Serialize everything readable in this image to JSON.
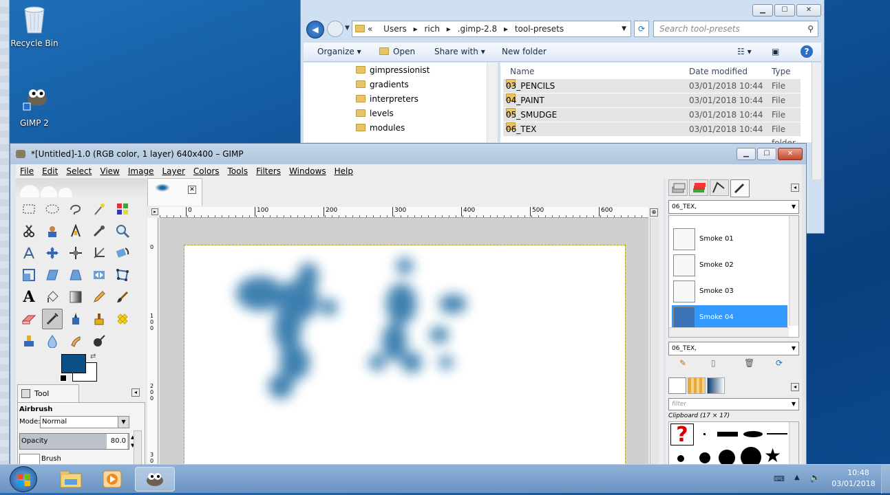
{
  "desktop": {
    "icons": [
      {
        "label": "Recycle Bin"
      },
      {
        "label": "GIMP 2"
      }
    ]
  },
  "explorer": {
    "window_controls": {
      "minimize": "▁",
      "maximize": "☐",
      "close": "✕"
    },
    "breadcrumb": [
      "«",
      "Users",
      "rich",
      ".gimp-2.8",
      "tool-presets"
    ],
    "search_placeholder": "Search tool-presets",
    "toolbar": {
      "organize": "Organize",
      "open": "Open",
      "share_with": "Share with",
      "new_folder": "New folder"
    },
    "nav_items": [
      "gimpressionist",
      "gradients",
      "interpreters",
      "levels",
      "modules"
    ],
    "columns": {
      "name": "Name",
      "date": "Date modified",
      "type": "Type"
    },
    "files": [
      {
        "name": "03_PENCILS",
        "date": "03/01/2018 10:44",
        "type": "File folder"
      },
      {
        "name": "04_PAINT",
        "date": "03/01/2018 10:44",
        "type": "File folder"
      },
      {
        "name": "05_SMUDGE",
        "date": "03/01/2018 10:44",
        "type": "File folder"
      },
      {
        "name": "06_TEX",
        "date": "03/01/2018 10:44",
        "type": "File folder"
      }
    ]
  },
  "gimp": {
    "title": "*[Untitled]-1.0 (RGB color, 1 layer) 640x400 – GIMP",
    "menu": [
      "File",
      "Edit",
      "Select",
      "View",
      "Image",
      "Layer",
      "Colors",
      "Tools",
      "Filters",
      "Windows",
      "Help"
    ],
    "fg_color": "#0b4f86",
    "tool_options": {
      "tab_label": "Tool Options",
      "tool_name": "Airbrush",
      "mode_label": "Mode:",
      "mode_value": "Normal",
      "opacity_label": "Opacity",
      "opacity_value": "80.0",
      "brush_label": "Brush"
    },
    "ruler_ticks": [
      "0",
      "100",
      "200",
      "300",
      "400",
      "500",
      "600"
    ],
    "vruler_ticks": [
      "0",
      "1 0 0",
      "2 0 0",
      "3 0"
    ],
    "presets": {
      "tag_filter": "06_TEX,",
      "items": [
        "Smoke 01",
        "Smoke 02",
        "Smoke 03",
        "Smoke 04"
      ],
      "selected": "Smoke 04",
      "tag_entry": "06_TEX,"
    },
    "brushes": {
      "filter_placeholder": "filter",
      "current": "Clipboard (17 × 17)"
    }
  },
  "taskbar": {
    "time": "10:48",
    "date": "03/01/2018"
  }
}
